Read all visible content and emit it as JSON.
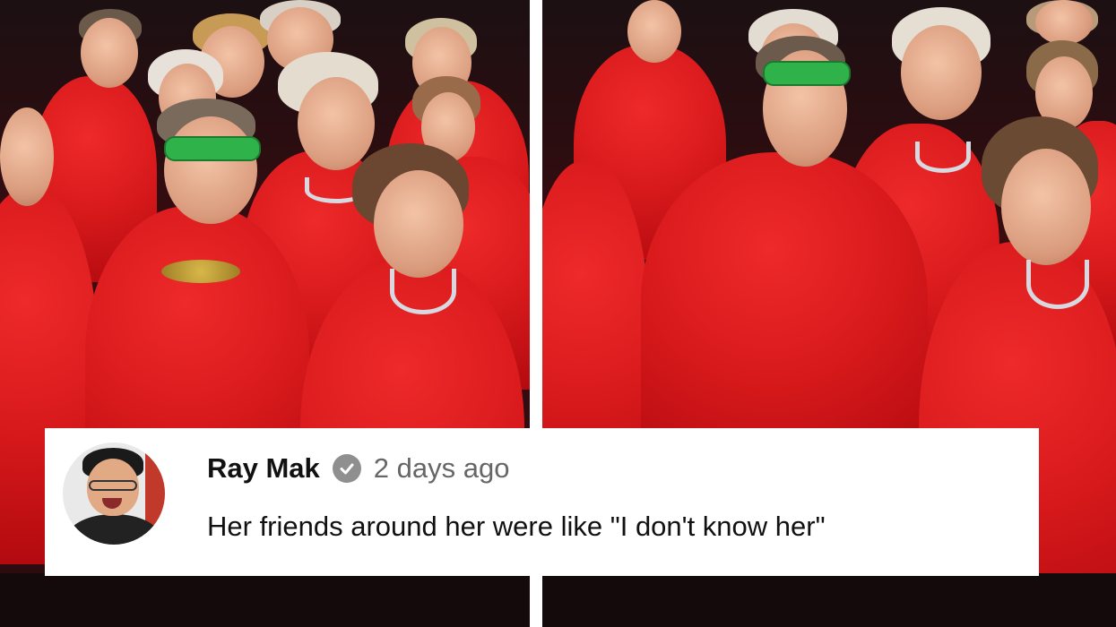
{
  "comment": {
    "author": "Ray Mak",
    "timestamp": "2 days ago",
    "text": "Her friends around her were like \"I don't know her\"",
    "avatar_icon": "user-avatar-icon",
    "verified_icon": "verified-check-icon"
  },
  "colors": {
    "dress_red": "#d91a1c",
    "backdrop": "#2a0c0f",
    "glasses_green": "#2fb24a",
    "verified_gray": "#8f8f8f"
  }
}
